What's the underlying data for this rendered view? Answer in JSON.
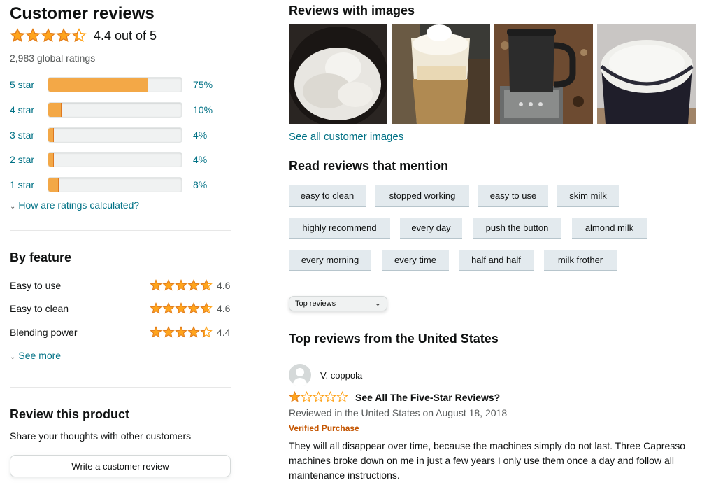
{
  "summary": {
    "title": "Customer reviews",
    "rating_text": "4.4 out of 5",
    "rating_value": 4.4,
    "global_ratings": "2,983 global ratings",
    "histogram": [
      {
        "label": "5 star",
        "pct_text": "75%",
        "pct": 75
      },
      {
        "label": "4 star",
        "pct_text": "10%",
        "pct": 10
      },
      {
        "label": "3 star",
        "pct_text": "4%",
        "pct": 4
      },
      {
        "label": "2 star",
        "pct_text": "4%",
        "pct": 4
      },
      {
        "label": "1 star",
        "pct_text": "8%",
        "pct": 8
      }
    ],
    "how_calculated": "How are ratings calculated?"
  },
  "by_feature": {
    "title": "By feature",
    "items": [
      {
        "name": "Easy to use",
        "value": "4.6",
        "rating": 4.6
      },
      {
        "name": "Easy to clean",
        "value": "4.6",
        "rating": 4.6
      },
      {
        "name": "Blending power",
        "value": "4.4",
        "rating": 4.4
      }
    ],
    "see_more": "See more"
  },
  "review_product": {
    "title": "Review this product",
    "subtitle": "Share your thoughts with other customers",
    "button": "Write a customer review"
  },
  "images_section": {
    "title": "Reviews with images",
    "see_all": "See all customer images"
  },
  "mentions": {
    "title": "Read reviews that mention",
    "chips": [
      "easy to clean",
      "stopped working",
      "easy to use",
      "skim milk",
      "highly recommend",
      "every day",
      "push the button",
      "almond milk",
      "every morning",
      "every time",
      "half and half",
      "milk frother"
    ]
  },
  "sort": {
    "selected": "Top reviews"
  },
  "top_reviews": {
    "title": "Top reviews from the United States",
    "review": {
      "author": "V. coppola",
      "rating": 1,
      "title": "See All The Five-Star Reviews?",
      "meta": "Reviewed in the United States on August 18, 2018",
      "verified": "Verified Purchase",
      "body": "They will all disappear over time, because the machines simply do not last. Three Capresso machines broke down on me in just a few years I only use them once a day and follow all maintenance instructions."
    }
  },
  "colors": {
    "star": "#ffa41c",
    "bar_fill": "#f3a847",
    "link": "#007185",
    "verified": "#c45500",
    "chip_bg": "#e3eaee"
  }
}
